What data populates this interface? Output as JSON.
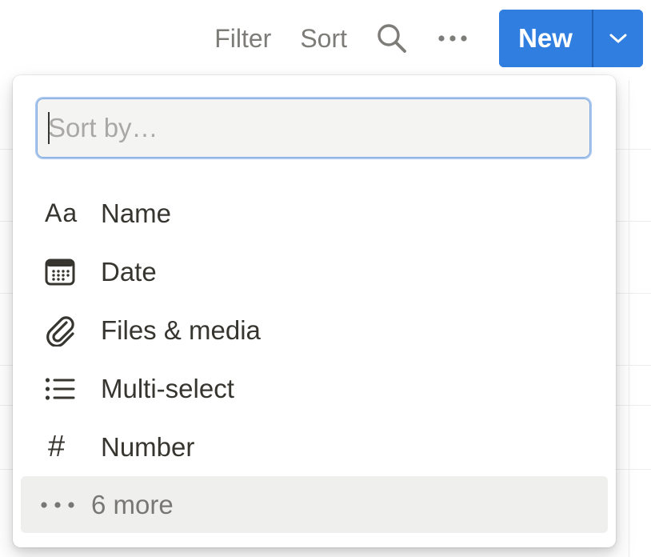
{
  "toolbar": {
    "filter_label": "Filter",
    "sort_label": "Sort",
    "search_icon": "search-icon",
    "more_icon": "more-horizontal-icon",
    "new_label": "New",
    "new_dropdown_icon": "chevron-down-icon"
  },
  "sort_popup": {
    "search": {
      "placeholder": "Sort by…",
      "value": ""
    },
    "properties": [
      {
        "label": "Name",
        "icon": "text-aa-icon",
        "icon_text": "Aa"
      },
      {
        "label": "Date",
        "icon": "calendar-icon"
      },
      {
        "label": "Files & media",
        "icon": "paperclip-icon"
      },
      {
        "label": "Multi-select",
        "icon": "list-icon"
      },
      {
        "label": "Number",
        "icon": "hash-icon",
        "icon_text": "#"
      }
    ],
    "more": {
      "label": "6 more",
      "icon": "more-horizontal-icon"
    }
  },
  "colors": {
    "accent": "#2f7ee0",
    "text": "#37352f",
    "muted": "#7d7c78",
    "focus_ring": "#a9c7ee"
  }
}
